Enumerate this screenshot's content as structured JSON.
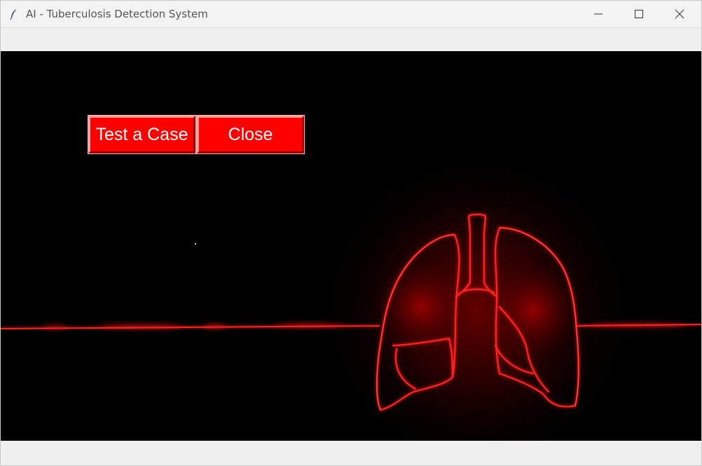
{
  "window": {
    "title": "AI - Tuberculosis Detection System",
    "icon": "feather-icon",
    "controls": [
      "minimize-icon",
      "maximize-icon",
      "close-icon"
    ]
  },
  "buttons": {
    "test_label": "Test a Case",
    "close_label": "Close"
  },
  "colors": {
    "canvas_bg": "#000000",
    "button_bg": "#ff0000",
    "button_text": "#ffffff",
    "lung_glow": "#ff1a1a"
  },
  "illustration": {
    "subject": "lungs-illustration",
    "style": "neon red outline with heartbeat line"
  }
}
